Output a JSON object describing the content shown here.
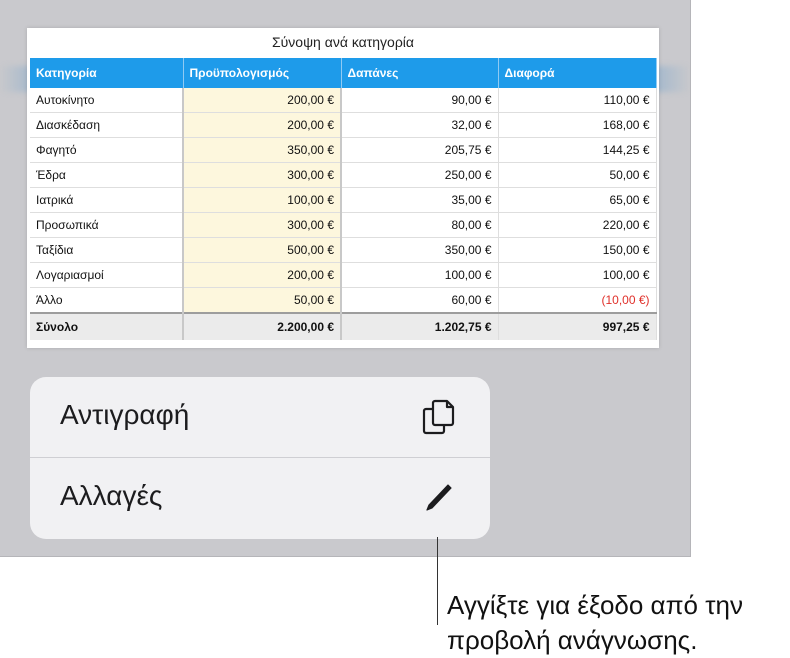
{
  "table": {
    "title": "Σύνοψη ανά κατηγορία",
    "headers": [
      "Κατηγορία",
      "Προϋπολογισμός",
      "Δαπάνες",
      "Διαφορά"
    ],
    "rows": [
      [
        "Αυτοκίνητο",
        "200,00 €",
        "90,00 €",
        "110,00 €"
      ],
      [
        "Διασκέδαση",
        "200,00 €",
        "32,00 €",
        "168,00 €"
      ],
      [
        "Φαγητό",
        "350,00 €",
        "205,75 €",
        "144,25 €"
      ],
      [
        "Έδρα",
        "300,00 €",
        "250,00 €",
        "50,00 €"
      ],
      [
        "Ιατρικά",
        "100,00 €",
        "35,00 €",
        "65,00 €"
      ],
      [
        "Προσωπικά",
        "300,00 €",
        "80,00 €",
        "220,00 €"
      ],
      [
        "Ταξίδια",
        "500,00 €",
        "350,00 €",
        "150,00 €"
      ],
      [
        "Λογαριασμοί",
        "200,00 €",
        "100,00 €",
        "100,00 €"
      ],
      [
        "Άλλο",
        "50,00 €",
        "60,00 €",
        "(10,00 €)"
      ]
    ],
    "total": [
      "Σύνολο",
      "2.200,00 €",
      "1.202,75 €",
      "997,25 €"
    ],
    "colors": {
      "header": "#1e9bea",
      "budget_fill": "#fdf7dd",
      "negative": "#e0302a"
    }
  },
  "menu": {
    "copy_label": "Αντιγραφή",
    "copy_icon": "copy-icon",
    "edit_label": "Αλλαγές",
    "edit_icon": "pencil-icon"
  },
  "callout": {
    "text": "Αγγίξτε για έξοδο από την προβολή ανάγνωσης."
  }
}
